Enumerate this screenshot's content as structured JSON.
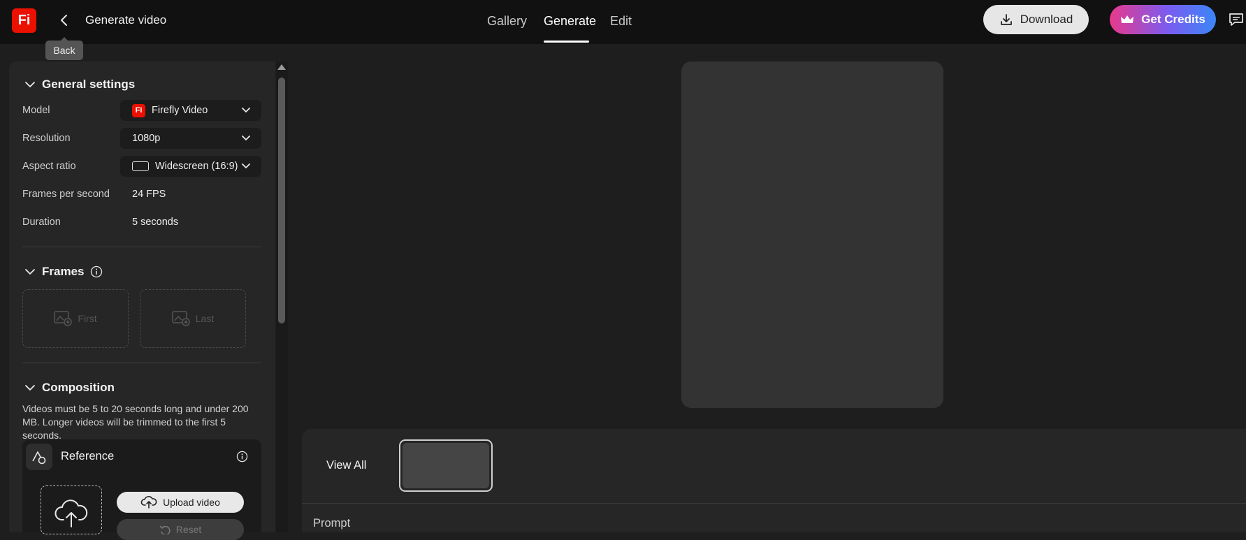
{
  "header": {
    "logo_text": "Fi",
    "title": "Generate video",
    "back_tooltip": "Back",
    "tabs": [
      {
        "label": "Gallery",
        "active": false
      },
      {
        "label": "Generate",
        "active": true
      },
      {
        "label": "Edit",
        "active": false
      }
    ],
    "download_label": "Download",
    "credits_label": "Get Credits"
  },
  "general_settings": {
    "heading": "General settings",
    "model": {
      "label": "Model",
      "value": "Firefly Video",
      "badge": "Fi"
    },
    "resolution": {
      "label": "Resolution",
      "value": "1080p"
    },
    "aspect_ratio": {
      "label": "Aspect ratio",
      "value": "Widescreen (16:9)"
    },
    "fps": {
      "label": "Frames per second",
      "value": "24 FPS"
    },
    "duration": {
      "label": "Duration",
      "value": "5 seconds"
    }
  },
  "frames": {
    "heading": "Frames",
    "first_label": "First",
    "last_label": "Last"
  },
  "composition": {
    "heading": "Composition",
    "description": "Videos must be 5 to 20 seconds long and under 200 MB. Longer videos will be trimmed to the first 5 seconds.",
    "reference_title": "Reference",
    "upload_label": "Upload video",
    "reset_label": "Reset"
  },
  "bottom": {
    "view_all_label": "View All",
    "prompt_label": "Prompt"
  },
  "colors": {
    "accent_red": "#eb1000",
    "credits_gradient_start": "#e8398c",
    "credits_gradient_end": "#3b86f7"
  }
}
